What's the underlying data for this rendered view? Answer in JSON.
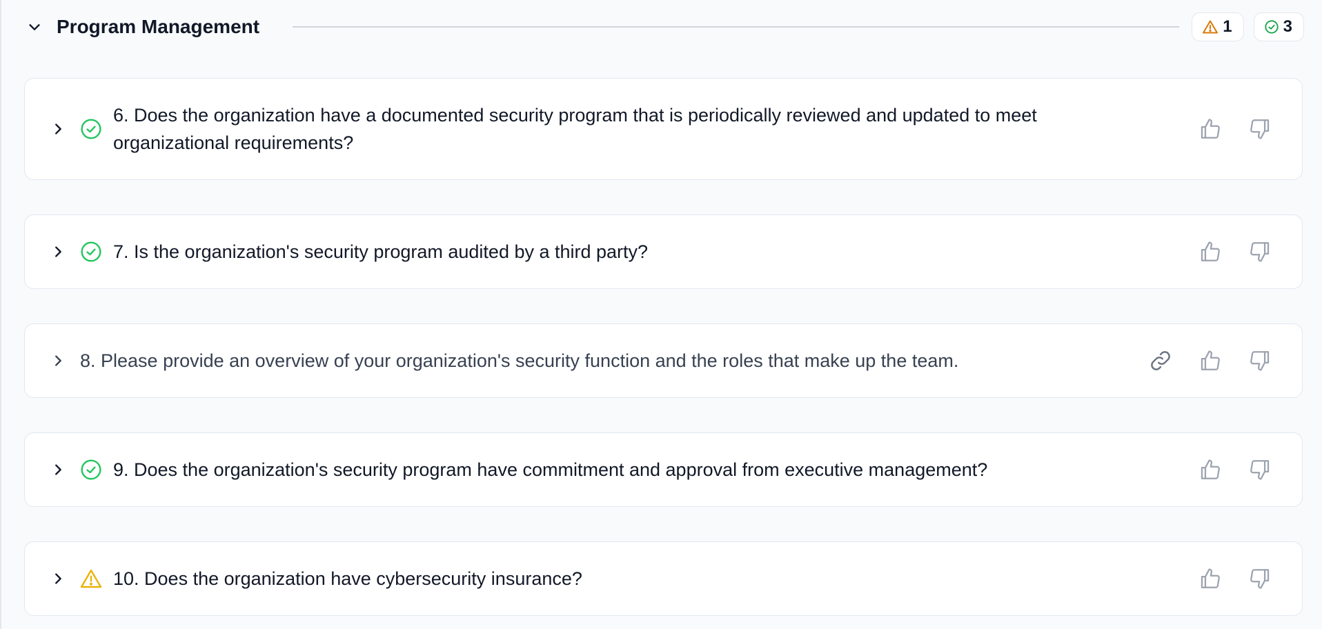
{
  "section": {
    "title": "Program Management",
    "badges": {
      "warning_count": "1",
      "success_count": "3"
    }
  },
  "questions": [
    {
      "text": "6. Does the organization have a documented security program that is periodically reviewed and updated to meet organizational requirements?",
      "status": "success"
    },
    {
      "text": "7. Is the organization's security program audited by a third party?",
      "status": "success"
    },
    {
      "text": "8. Please provide an overview of your organization's security function and the roles that make up the team.",
      "status": "none"
    },
    {
      "text": "9. Does the organization's security program have commitment and approval from executive management?",
      "status": "success"
    },
    {
      "text": "10. Does the organization have cybersecurity insurance?",
      "status": "warning"
    }
  ],
  "colors": {
    "success": "#22c55e",
    "warning": "#eab308",
    "warning_badge": "#d97706",
    "icon_muted": "#9ca3af"
  }
}
